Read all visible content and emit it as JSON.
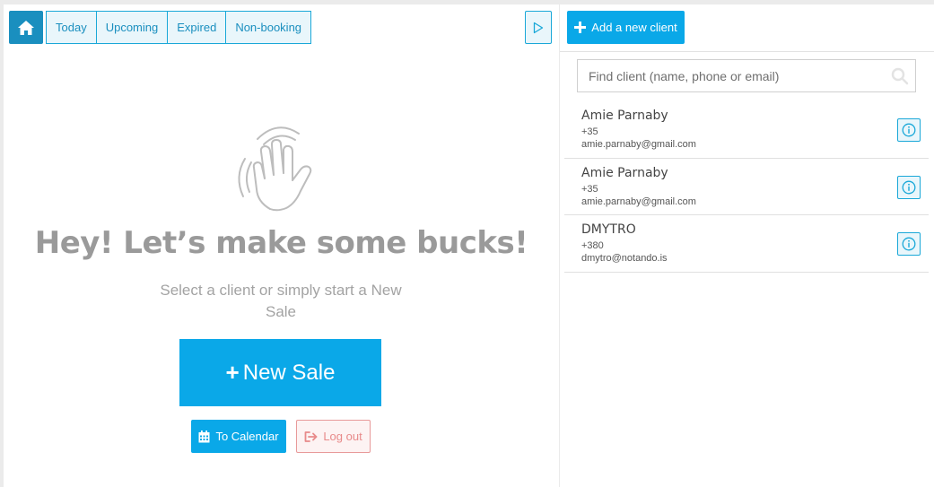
{
  "nav": {
    "tabs": [
      {
        "label": "Today"
      },
      {
        "label": "Upcoming"
      },
      {
        "label": "Expired"
      },
      {
        "label": "Non-booking"
      }
    ]
  },
  "welcome": {
    "greeting": "Hey! Let’s make some bucks!",
    "subtext": "Select a client or simply start a New Sale",
    "new_sale_label": "New Sale",
    "calendar_label": "To Calendar",
    "logout_label": "Log out"
  },
  "clients_panel": {
    "add_client_label": "Add a new client",
    "search_placeholder": "Find client (name, phone or email)",
    "clients": [
      {
        "name": "Amie Parnaby",
        "phone": "+35",
        "email": "amie.parnaby@gmail.com"
      },
      {
        "name": "Amie Parnaby",
        "phone": "+35",
        "email": "amie.parnaby@gmail.com"
      },
      {
        "name": "DMYTRO",
        "phone": "+380",
        "email": "dmytro@notando.is"
      }
    ]
  },
  "colors": {
    "accent": "#0aa8e8",
    "home": "#1a8fbf",
    "danger": "#e88a8a",
    "heading": "#9a9a9a"
  },
  "icons": [
    "home-icon",
    "play-icon",
    "wave-hand-icon",
    "plus-icon",
    "calendar-icon",
    "logout-icon",
    "search-icon",
    "info-icon"
  ]
}
